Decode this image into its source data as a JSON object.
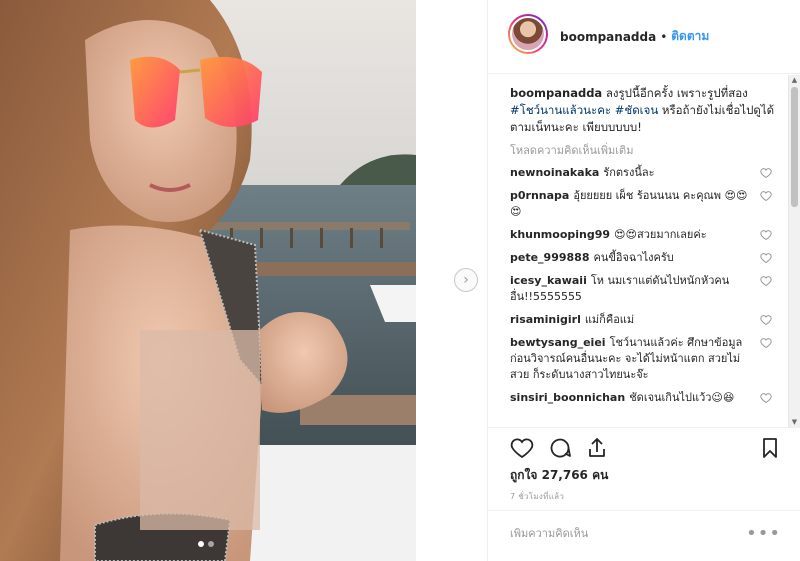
{
  "post": {
    "username": "boompanadda",
    "separator": "•",
    "follow_label": "ติดตาม",
    "caption_user": "boompanadda",
    "caption_text_1": "ลงรูปนี้อีกครั้ง เพราะรูปที่สอง",
    "caption_tag_1": "#โชว์นานแล้วนะคะ",
    "caption_tag_2": "#ชัดเจน",
    "caption_text_2": "หรือถ้ายังไม่เชื่อไปดูได้ตามเน็ทนะคะ เพียบบบบบ!",
    "load_more": "โหลดความคิดเห็นเพิ่มเติม",
    "likes": "ถูกใจ 27,766 คน",
    "time": "7 ชั่วโมงที่แล้ว",
    "add_comment_placeholder": "เพิ่มความคิดเห็น",
    "more_options": "•••"
  },
  "comments": [
    {
      "user": "newnoinakaka",
      "text": "รักตรงนี้ละ"
    },
    {
      "user": "p0rnnapa",
      "text": "อุ้ยยยยย เผ็ช ร้อนนนน คะคุณพ 😍😍😍"
    },
    {
      "user": "khunmooping99",
      "text": "😍😍สวยมากเลยค่ะ"
    },
    {
      "user": "pete_999888",
      "text": "คนขี้อิจฉาไงครับ"
    },
    {
      "user": "icesy_kawaii",
      "text": "โห นมเราแต่ดันไปหนักหัวคนอื่น!!5555555"
    },
    {
      "user": "risaminigirl",
      "text": "แม่ก็คือแม่"
    },
    {
      "user": "bewtysang_eiei",
      "text": "โชว์นานแล้วค่ะ ศึกษาข้อมูลก่อนวิจารณ์คนอื่นนะคะ จะได้ไม่หน้าแตก สวยไม่สวย ก็ระดับนางสาวไทยนะจ๊ะ"
    },
    {
      "user": "sinsiri_boonnichan",
      "text": "ชัดเจนเกินไปแว้ว😉😆"
    }
  ],
  "colors": {
    "accent": "#3897f0",
    "hashtag": "#003569",
    "muted": "#999999"
  },
  "icons": {
    "next": "chevron-right-icon",
    "like": "heart-icon",
    "comment": "comment-icon",
    "share": "share-icon",
    "save": "bookmark-icon"
  }
}
